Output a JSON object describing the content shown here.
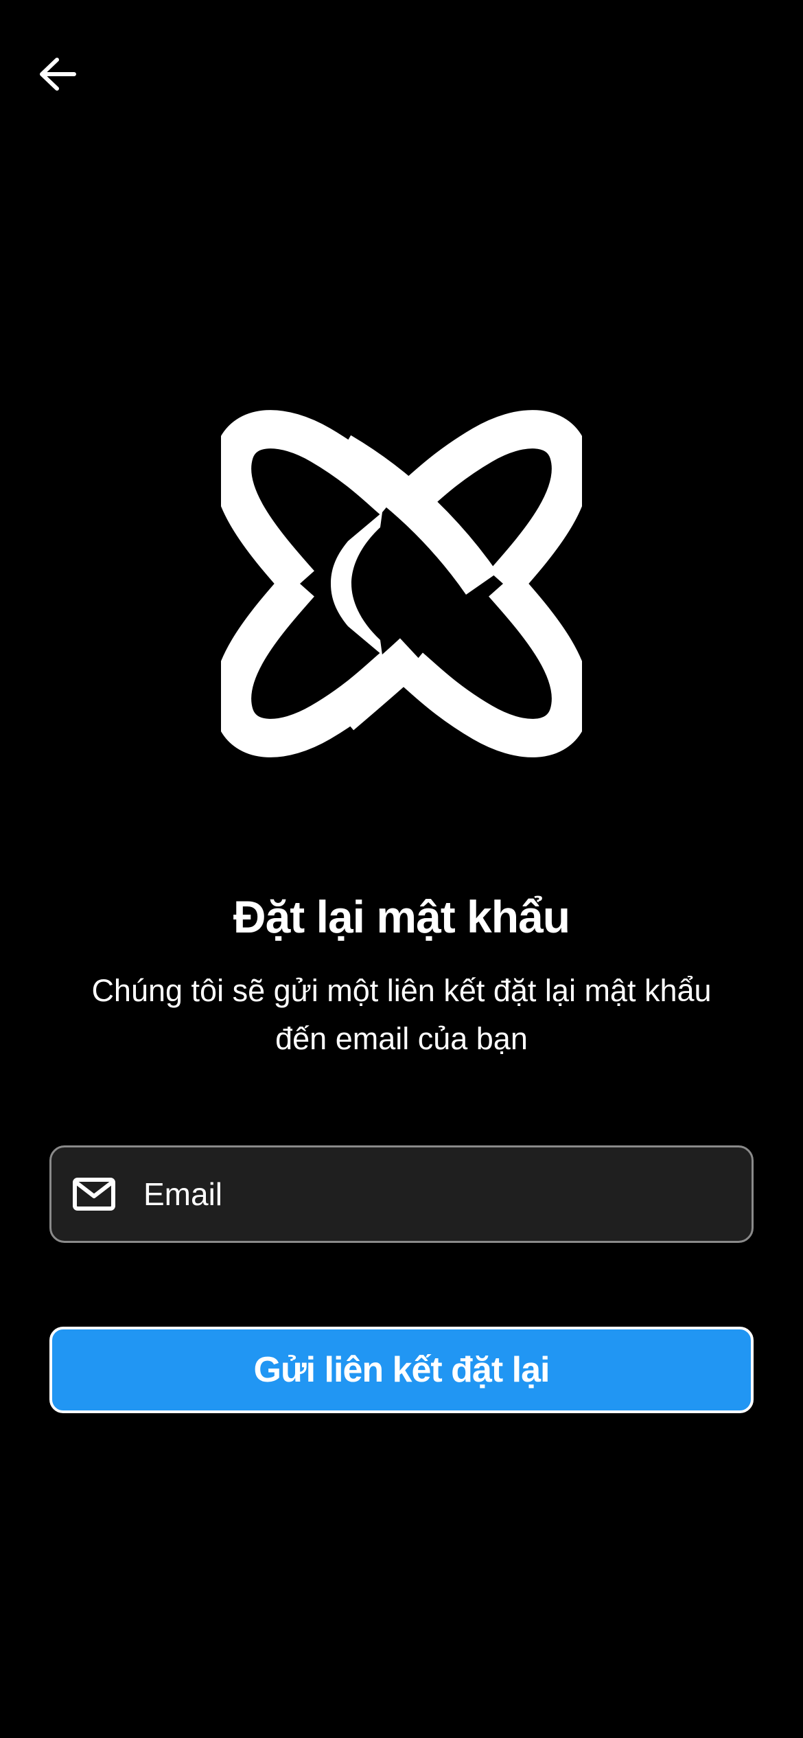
{
  "header": {
    "back_icon": "arrow-left-icon"
  },
  "logo": {
    "icon": "app-logo-icon"
  },
  "title": "Đặt lại mật khẩu",
  "subtitle": {
    "line1": "Chúng tôi sẽ gửi một liên kết đặt lại mật khẩu",
    "line2": "đến email của bạn"
  },
  "email_field": {
    "icon": "mail-icon",
    "placeholder": "Email",
    "value": ""
  },
  "submit_button": {
    "label": "Gửi liên kết đặt lại"
  },
  "colors": {
    "background": "#000000",
    "button": "#2196f3",
    "field_background": "#1f1f1f",
    "field_border": "#8a8a8a",
    "text": "#ffffff"
  }
}
